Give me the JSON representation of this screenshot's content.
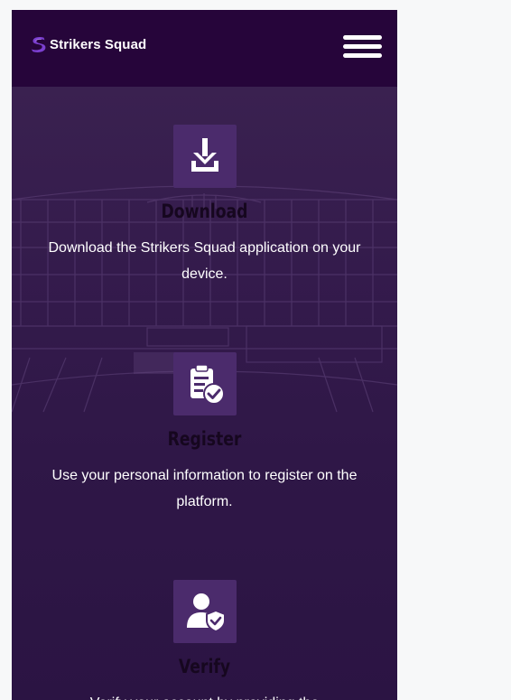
{
  "header": {
    "brand": "Strikers Squad",
    "logo_color": "#7b3fd0",
    "menu_icon": "hamburger-icon"
  },
  "colors": {
    "header_bg": "#26053a",
    "content_bg": "#341b4c",
    "icon_box_bg": "#4b2b6c",
    "title_color": "#16071f",
    "text_color": "#ffffff",
    "page_bg": "#f7f8f9"
  },
  "steps": [
    {
      "icon": "download-icon",
      "title": "Download",
      "description": "Download the Strikers Squad application on your device."
    },
    {
      "icon": "clipboard-check-icon",
      "title": "Register",
      "description": "Use your personal information to register on the platform."
    },
    {
      "icon": "user-shield-icon",
      "title": "Verify",
      "description": "Verify your account by providing the"
    }
  ]
}
